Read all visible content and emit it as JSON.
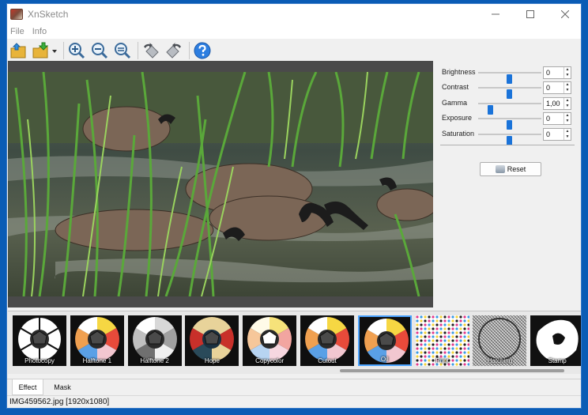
{
  "window": {
    "title": "XnSketch"
  },
  "menu": [
    "File",
    "Info"
  ],
  "toolbar": {
    "buttons": [
      "open-folder-icon",
      "save-icon",
      "zoom-in-icon",
      "zoom-out-icon",
      "zoom-fit-icon",
      "rotate-left-icon",
      "rotate-right-icon",
      "help-icon"
    ]
  },
  "controls": {
    "items": [
      {
        "label": "Brightness",
        "value": "0",
        "level": 0.5
      },
      {
        "label": "Contrast",
        "value": "0",
        "level": 0.5
      },
      {
        "label": "Gamma",
        "value": "1,00",
        "level": 0.2
      },
      {
        "label": "Exposure",
        "value": "0",
        "level": 0.5
      },
      {
        "label": "Saturation",
        "value": "0",
        "level": 0.5
      }
    ],
    "reset_label": "Reset"
  },
  "effects": [
    {
      "label": "Photocopy",
      "style": "bw"
    },
    {
      "label": "Halftone 1",
      "style": "color"
    },
    {
      "label": "Halftone 2",
      "style": "gray"
    },
    {
      "label": "Hope",
      "style": "hope"
    },
    {
      "label": "Copycolor",
      "style": "soft"
    },
    {
      "label": "Cutout",
      "style": "color"
    },
    {
      "label": "Oil",
      "style": "color",
      "selected": true
    },
    {
      "label": "Print",
      "style": "print"
    },
    {
      "label": "Hatching",
      "style": "hatch"
    },
    {
      "label": "Stamp",
      "style": "stamp"
    }
  ],
  "tabs": [
    "Effect",
    "Mask"
  ],
  "status": {
    "text": "IMG459562.jpg [1920x1080]"
  },
  "colors": {
    "accent": "#1a73d9",
    "selection": "#4aa3ff",
    "frame": "#0a5cb5"
  }
}
